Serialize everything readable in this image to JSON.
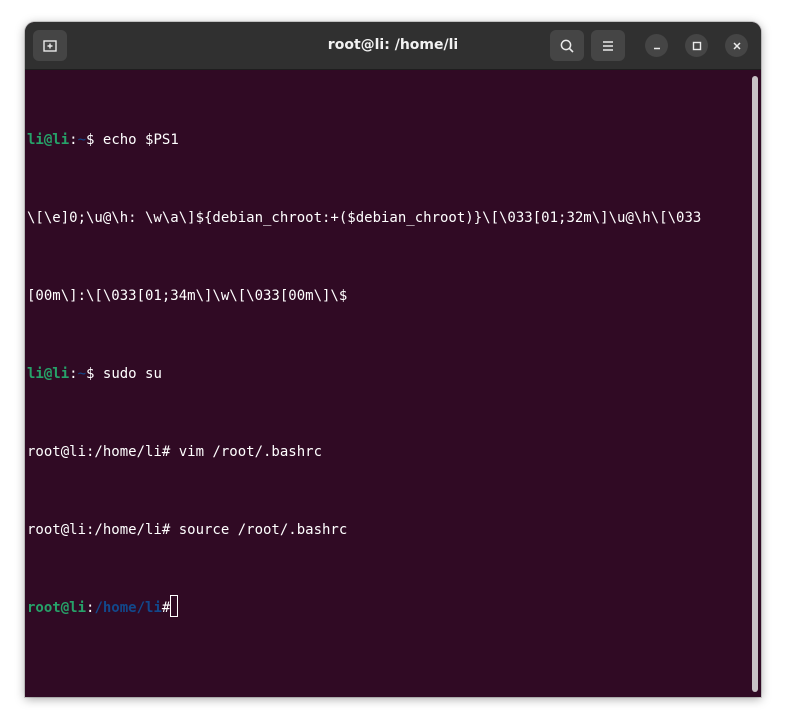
{
  "window": {
    "title": "root@li: /home/li"
  },
  "header_buttons": {
    "new_tab_icon": "new-tab-icon",
    "search_icon": "search-icon",
    "menu_icon": "hamburger-menu-icon",
    "minimize_icon": "minimize-icon",
    "maximize_icon": "maximize-icon",
    "close_icon": "close-icon"
  },
  "terminal": {
    "lines": [
      {
        "user_host": "li@li",
        "sep": ":",
        "path": "~",
        "sym": "$ ",
        "command": "echo $PS1"
      },
      {
        "text": "\\[\\e]0;\\u@\\h: \\w\\a\\]${debian_chroot:+($debian_chroot)}\\[\\033[01;32m\\]\\u@\\h\\[\\033"
      },
      {
        "text": "[00m\\]:\\[\\033[01;34m\\]\\w\\[\\033[00m\\]\\$"
      },
      {
        "user_host": "li@li",
        "sep": ":",
        "path": "~",
        "sym": "$ ",
        "command": "sudo su"
      },
      {
        "text": "root@li:/home/li# vim /root/.bashrc"
      },
      {
        "text": "root@li:/home/li# source /root/.bashrc"
      },
      {
        "user_host": "root@li",
        "sep": ":",
        "path": "/home/li",
        "sym": "#",
        "command": ""
      }
    ]
  },
  "colors": {
    "background": "#300a24",
    "titlebar": "#303030",
    "prompt_user": "#26a269",
    "prompt_path": "#12488b",
    "text": "#ffffff"
  }
}
